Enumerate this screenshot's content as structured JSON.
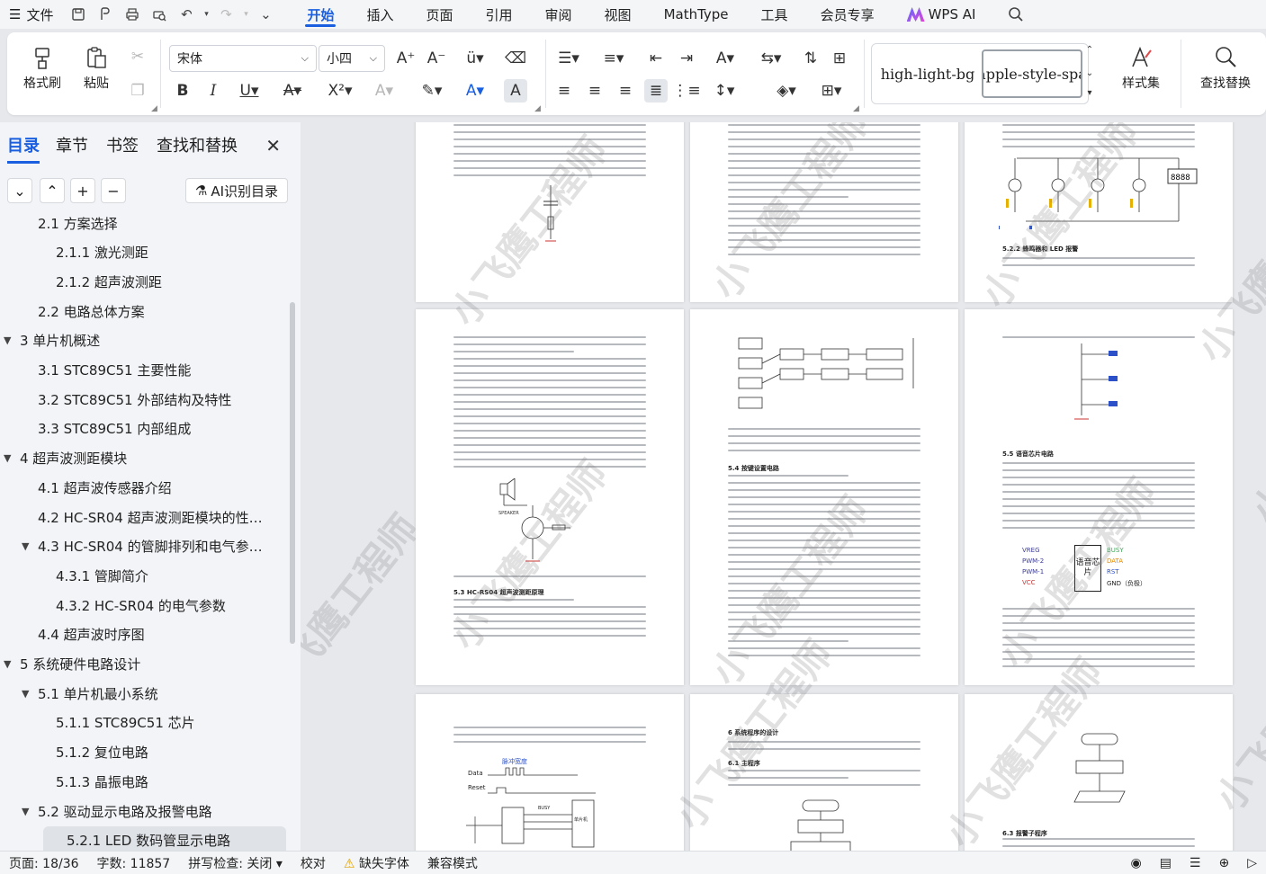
{
  "menubar": {
    "file_label": "文件",
    "tabs": [
      "开始",
      "插入",
      "页面",
      "引用",
      "审阅",
      "视图",
      "MathType",
      "工具",
      "会员专享"
    ],
    "active_tab": "开始",
    "wps_ai": "WPS AI"
  },
  "ribbon": {
    "format_painter": "格式刷",
    "paste": "粘贴",
    "font_name": "宋体",
    "font_size": "小四",
    "styles": [
      "high-light-bg",
      "apple-style-spa"
    ],
    "style_set": "样式集",
    "find_replace": "查找替换"
  },
  "nav": {
    "tabs": [
      "目录",
      "章节",
      "书签",
      "查找和替换"
    ],
    "active_tab": "目录",
    "ai_button": "AI识别目录",
    "toc": [
      {
        "label": "2.1 方案选择",
        "level": 1,
        "arrow": ""
      },
      {
        "label": "2.1.1  激光测距",
        "level": 2,
        "arrow": ""
      },
      {
        "label": "2.1.2  超声波测距",
        "level": 2,
        "arrow": ""
      },
      {
        "label": "2.2 电路总体方案",
        "level": 1,
        "arrow": ""
      },
      {
        "label": "3 单片机概述",
        "level": 0,
        "arrow": "▼"
      },
      {
        "label": "3.1 STC89C51 主要性能",
        "level": 1,
        "arrow": ""
      },
      {
        "label": "3.2 STC89C51 外部结构及特性",
        "level": 1,
        "arrow": ""
      },
      {
        "label": "3.3 STC89C51 内部组成",
        "level": 1,
        "arrow": ""
      },
      {
        "label": "4  超声波测距模块",
        "level": 0,
        "arrow": "▼"
      },
      {
        "label": "4.1  超声波传感器介绍",
        "level": 1,
        "arrow": ""
      },
      {
        "label": "4.2 HC-SR04 超声波测距模块的性…",
        "level": 1,
        "arrow": ""
      },
      {
        "label": "4.3 HC-SR04 的管脚排列和电气参…",
        "level": 1,
        "arrow": "▼"
      },
      {
        "label": "4.3.1  管脚简介",
        "level": 2,
        "arrow": ""
      },
      {
        "label": "4.3.2 HC-SR04 的电气参数",
        "level": 2,
        "arrow": ""
      },
      {
        "label": "4.4 超声波时序图",
        "level": 1,
        "arrow": ""
      },
      {
        "label": "5 系统硬件电路设计",
        "level": 0,
        "arrow": "▼"
      },
      {
        "label": "5.1 单片机最小系统",
        "level": 1,
        "arrow": "▼"
      },
      {
        "label": "5.1.1 STC89C51 芯片",
        "level": 2,
        "arrow": ""
      },
      {
        "label": "5.1.2  复位电路",
        "level": 2,
        "arrow": ""
      },
      {
        "label": "5.1.3  晶振电路",
        "level": 2,
        "arrow": ""
      },
      {
        "label": "5.2  驱动显示电路及报警电路",
        "level": 1,
        "arrow": "▼"
      },
      {
        "label": "5.2.1   LED 数码管显示电路",
        "level": 2,
        "arrow": "",
        "active": true
      }
    ]
  },
  "doc": {
    "watermark": "小飞鹰工程师",
    "headings": {
      "p3": "5.2.2  蜂鸣器和 LED 报警",
      "p5a": "5.4  按键设置电路",
      "p4": "5.3 HC-RS04 超声波测距原理",
      "p6": "5.5  语音芯片电路",
      "p8a": "6 系统程序的设计",
      "p8b": "6.1 主程序",
      "p9": "6.3 报警子程序"
    },
    "chip": {
      "center_label": "语音芯片",
      "left_pins": [
        "VREG",
        "PWM-2",
        "PWM-1",
        "VCC"
      ],
      "right_pins": [
        "BUSY",
        "DATA",
        "RST",
        "GND（负极）"
      ]
    },
    "p7_labels": {
      "signal": "脉冲宽度",
      "data": "Data",
      "reset": "Reset",
      "busy": "BUSY",
      "mcu": "单片机"
    }
  },
  "status": {
    "page": "页面: 18/36",
    "words": "字数: 11857",
    "spell": "拼写检查: 关闭",
    "proof": "校对",
    "missing_font": "缺失字体",
    "compat": "兼容模式"
  },
  "colors": {
    "accent": "#1a5fe0",
    "chip_right_text": "#3aa655",
    "chip_left_text": "#3b3b9a"
  }
}
